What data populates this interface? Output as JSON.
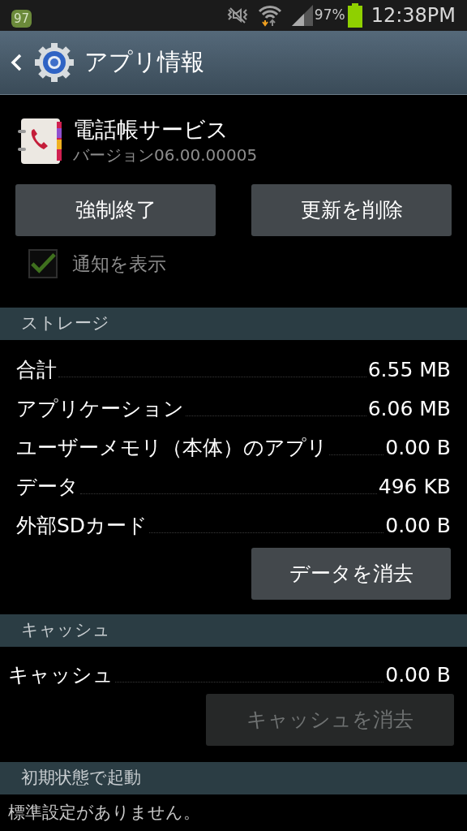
{
  "status_bar": {
    "notification_badge": "97",
    "battery": "97%",
    "time": "12:38PM"
  },
  "action_bar": {
    "title": "アプリ情報"
  },
  "app": {
    "name": "電話帳サービス",
    "version": "バージョン06.00.00005"
  },
  "buttons": [
    {
      "label": "強制終了",
      "disabled": false
    },
    {
      "label": "更新を削除",
      "disabled": false
    }
  ],
  "notification_checkbox": {
    "label": "通知を表示",
    "checked": true,
    "disabled": true
  },
  "storage": {
    "header": "ストレージ",
    "rows": [
      {
        "label": "合計",
        "value": "6.55 MB"
      },
      {
        "label": "アプリケーション",
        "value": "6.06 MB"
      },
      {
        "label": "ユーザーメモリ（本体）のアプリ",
        "value": "0.00 B"
      },
      {
        "label": "データ",
        "value": "496 KB"
      },
      {
        "label": "外部SDカード",
        "value": "0.00 B"
      }
    ],
    "button": {
      "label": "データを消去",
      "disabled": false
    }
  },
  "cache": {
    "header": "キャッシュ",
    "rows": [
      {
        "label": "キャッシュ",
        "value": "0.00 B"
      }
    ],
    "button": {
      "label": "キャッシュを消去",
      "disabled": true
    }
  },
  "launch_defaults": {
    "header": "初期状態で起動",
    "text": "標準設定がありません。"
  }
}
